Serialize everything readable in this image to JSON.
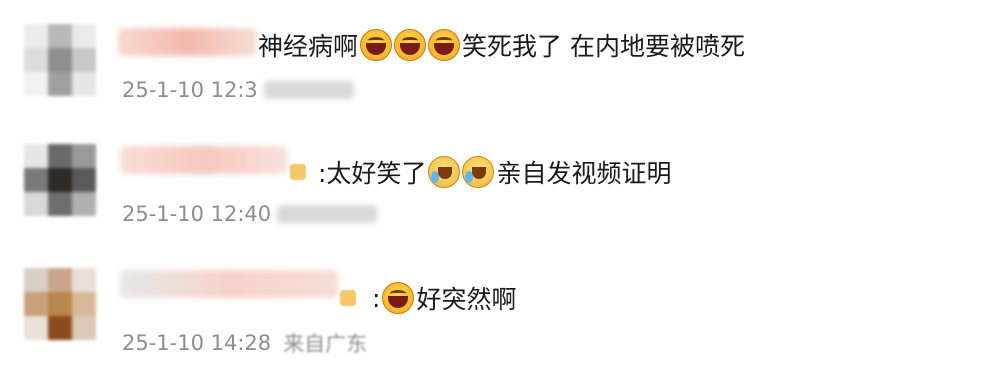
{
  "comments": [
    {
      "text_a": "神经病啊",
      "text_b": "笑死我了 在内地要被喷死",
      "time": "25-1-10 12:3",
      "emojis": [
        "laugh-icon",
        "laugh-icon",
        "laugh-icon"
      ]
    },
    {
      "text_prefix": ":太好笑了",
      "text_suffix": " 亲自发视频证明",
      "time": "25-1-10 12:40",
      "emojis": [
        "cry-laugh-icon",
        "cry-laugh-icon"
      ]
    },
    {
      "text_prefix": ":",
      "text_suffix": "好突然啊",
      "time": "25-1-10 14:28",
      "location": "来自广东",
      "emojis": [
        "laugh-icon"
      ]
    }
  ],
  "colors": {
    "text": "#1a1a1a",
    "time": "#8e8e8e",
    "emoji_yellow": "#f5a623",
    "badge": "#f5c66b"
  }
}
